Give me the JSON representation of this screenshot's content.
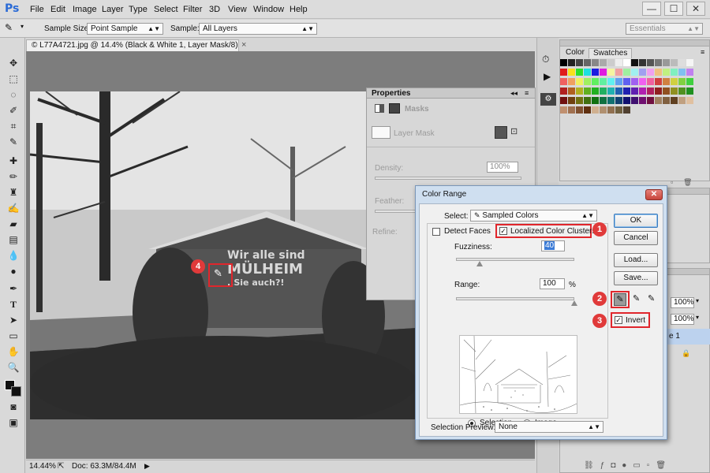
{
  "app": {
    "logo": "Ps"
  },
  "menu": [
    "File",
    "Edit",
    "Image",
    "Layer",
    "Type",
    "Select",
    "Filter",
    "3D",
    "View",
    "Window",
    "Help"
  ],
  "window_controls": {
    "minimize": "—",
    "maximize": "☐",
    "close": "✕"
  },
  "options_bar": {
    "sample_size_label": "Sample Size:",
    "sample_size_value": "Point Sample",
    "sample_label": "Sample:",
    "sample_value": "All Layers",
    "workspace": "Essentials"
  },
  "document": {
    "tab_title": "© L77A4721.jpg @ 14.4% (Black & White 1, Layer Mask/8) *",
    "tab_close": "×",
    "zoom": "14.44%",
    "doc_info": "Doc: 63.3M/84.4M"
  },
  "photo": {
    "sign_line1": "Wir alle sind",
    "sign_line2": "MÜLHEIM",
    "sign_line3": "..Sie auch?!"
  },
  "swatches_panel": {
    "tab_color": "Color",
    "tab_swatches": "Swatches"
  },
  "properties": {
    "title": "Properties",
    "masks_label": "Masks",
    "layer_mask_label": "Layer Mask",
    "density_label": "Density:",
    "density_value": "100%",
    "feather_label": "Feather:",
    "refine_label": "Refine:"
  },
  "layers_panel": {
    "opacity_value": "100%",
    "fill_value": "100%",
    "layer_name_fragment": "e 1"
  },
  "color_range": {
    "title": "Color Range",
    "close": "✕",
    "select_label": "Select:",
    "select_value": "Sampled Colors",
    "detect_faces_label": "Detect Faces",
    "detect_faces_checked": false,
    "localized_label": "Localized Color Clusters",
    "localized_checked": true,
    "fuzziness_label": "Fuzziness:",
    "fuzziness_value": "40",
    "range_label": "Range:",
    "range_value": "100",
    "range_unit": "%",
    "ok": "OK",
    "cancel": "Cancel",
    "load": "Load...",
    "save": "Save...",
    "invert_label": "Invert",
    "invert_checked": true,
    "selection_label": "Selection",
    "image_label": "Image",
    "selection_preview_label": "Selection Preview:",
    "selection_preview_value": "None",
    "fuzziness_fraction": 0.2,
    "range_fraction": 1.0
  },
  "callouts": [
    "1",
    "2",
    "3",
    "4"
  ],
  "colors": {
    "callout_red": "#e0262c",
    "dialog_border": "#7a96b8",
    "ps_blue": "#2b6bd6"
  }
}
